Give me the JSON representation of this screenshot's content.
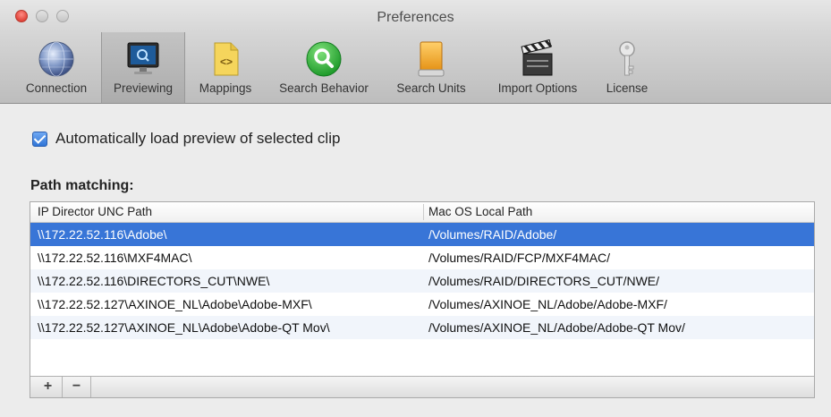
{
  "window": {
    "title": "Preferences"
  },
  "toolbar": {
    "items": [
      {
        "label": "Connection",
        "icon": "globe-icon",
        "selected": false
      },
      {
        "label": "Previewing",
        "icon": "monitor-icon",
        "selected": true
      },
      {
        "label": "Mappings",
        "icon": "code-file-icon",
        "selected": false
      },
      {
        "label": "Search Behavior",
        "icon": "magnifier-icon",
        "selected": false
      },
      {
        "label": "Search Units",
        "icon": "drive-icon",
        "selected": false
      },
      {
        "label": "Import Options",
        "icon": "clapperboard-icon",
        "selected": false
      },
      {
        "label": "License",
        "icon": "key-icon",
        "selected": false
      }
    ]
  },
  "previewing": {
    "auto_load_label": "Automatically load preview of selected clip",
    "auto_load_checked": true,
    "section_title": "Path matching:",
    "columns": [
      "IP Director UNC Path",
      "Mac OS Local Path"
    ],
    "rows": [
      {
        "unc": "\\\\172.22.52.116\\Adobe\\",
        "local": "/Volumes/RAID/Adobe/",
        "selected": true
      },
      {
        "unc": "\\\\172.22.52.116\\MXF4MAC\\",
        "local": "/Volumes/RAID/FCP/MXF4MAC/",
        "selected": false
      },
      {
        "unc": "\\\\172.22.52.116\\DIRECTORS_CUT\\NWE\\",
        "local": "/Volumes/RAID/DIRECTORS_CUT/NWE/",
        "selected": false
      },
      {
        "unc": "\\\\172.22.52.127\\AXINOE_NL\\Adobe\\Adobe-MXF\\",
        "local": "/Volumes/AXINOE_NL/Adobe/Adobe-MXF/",
        "selected": false
      },
      {
        "unc": "\\\\172.22.52.127\\AXINOE_NL\\Adobe\\Adobe-QT Mov\\",
        "local": "/Volumes/AXINOE_NL/Adobe/Adobe-QT Mov/",
        "selected": false
      }
    ],
    "add_label": "+",
    "remove_label": "−"
  }
}
